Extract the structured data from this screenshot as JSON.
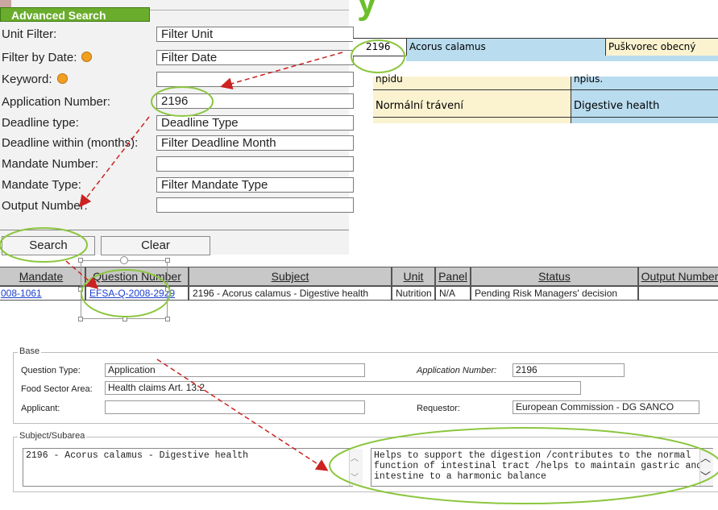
{
  "advanced_search": {
    "title": "Advanced Search",
    "fields": [
      {
        "label": "Unit Filter:",
        "value": "Filter Unit"
      },
      {
        "label": "Filter by Date:",
        "value": "Filter Date"
      },
      {
        "label": "Keyword:",
        "value": ""
      },
      {
        "label": "Application Number:",
        "value": "2196"
      },
      {
        "label": "Deadline type:",
        "value": "Deadline Type"
      },
      {
        "label": "Deadline within (months):",
        "value": "Filter Deadline Month"
      },
      {
        "label": "Mandate Number:",
        "value": ""
      },
      {
        "label": "Mandate Type:",
        "value": "Filter Mandate Type"
      },
      {
        "label": "Output Number:",
        "value": ""
      }
    ],
    "search_label": "Search",
    "clear_label": "Clear"
  },
  "excerpt": {
    "row1": {
      "number": "2196",
      "latin": "Acorus calamus",
      "czech": "Puškvorec obecný"
    },
    "row_partial": {
      "left": "npidu",
      "right": "npius."
    },
    "row2": {
      "czech": "Normální trávení",
      "english": "Digestive health"
    }
  },
  "results": {
    "headers": [
      "Mandate Number",
      "Question Number",
      "Subject",
      "Unit",
      "Panel",
      "Status",
      "Output Number"
    ],
    "row": {
      "mandate_number": "008-1061",
      "question_number": "EFSA-Q-2008-2929",
      "subject": "2196 - Acorus calamus - Digestive health",
      "unit": "Nutrition",
      "panel": "N/A",
      "status": "Pending Risk Managers' decision",
      "output_number": ""
    }
  },
  "detail": {
    "base_legend": "Base",
    "question_type_label": "Question Type:",
    "question_type_value": "Application",
    "application_number_label": "Application Number:",
    "application_number_value": "2196",
    "food_sector_label": "Food Sector Area:",
    "food_sector_value": "Health claims Art. 13.2",
    "applicant_label": "Applicant:",
    "applicant_value": "",
    "requestor_label": "Requestor:",
    "requestor_value": "European Commission - DG SANCO",
    "subject_legend": "Subject/Subarea",
    "subject_value": "2196 - Acorus calamus - Digestive health",
    "subarea_value": "Helps to support the digestion /contributes to the normal function of intestinal tract /helps to maintain gastric and intestine to a harmonic balance"
  },
  "colors": {
    "accent_green": "#6aac2b",
    "annotation_red": "#cc2222",
    "excerpt_blue": "#b9dcef",
    "excerpt_cream": "#fbf3d0",
    "link_blue": "#1a3fd0"
  }
}
